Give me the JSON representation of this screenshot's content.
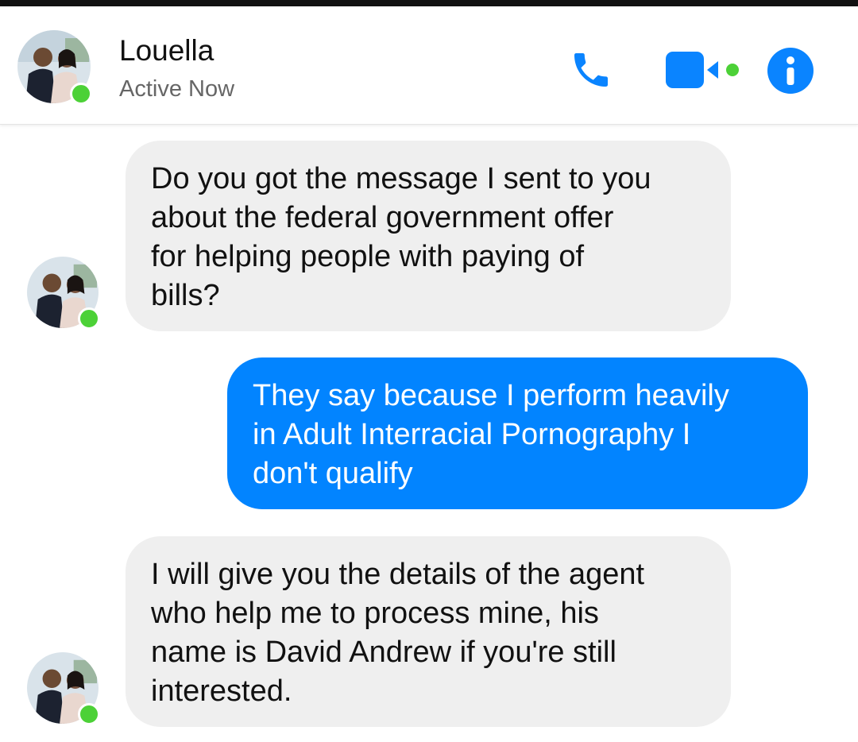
{
  "header": {
    "contact_name": "Louella",
    "status": "Active Now",
    "accent_color": "#0a84ff",
    "online_color": "#4cd137",
    "actions": [
      {
        "icon": "phone-icon"
      },
      {
        "icon": "video-camera-icon"
      },
      {
        "icon": "info-icon"
      }
    ]
  },
  "messages": [
    {
      "direction": "incoming",
      "text": "Do you got the message I sent to you\nabout the federal government offer\nfor helping people with paying of\nbills?"
    },
    {
      "direction": "outgoing",
      "text": "They say because I perform heavily\nin Adult Interracial Pornography I\ndon't qualify"
    },
    {
      "direction": "incoming",
      "text": "I will give you the details of the agent\nwho help me to process mine, his\nname is David Andrew if you're still\ninterested."
    }
  ]
}
